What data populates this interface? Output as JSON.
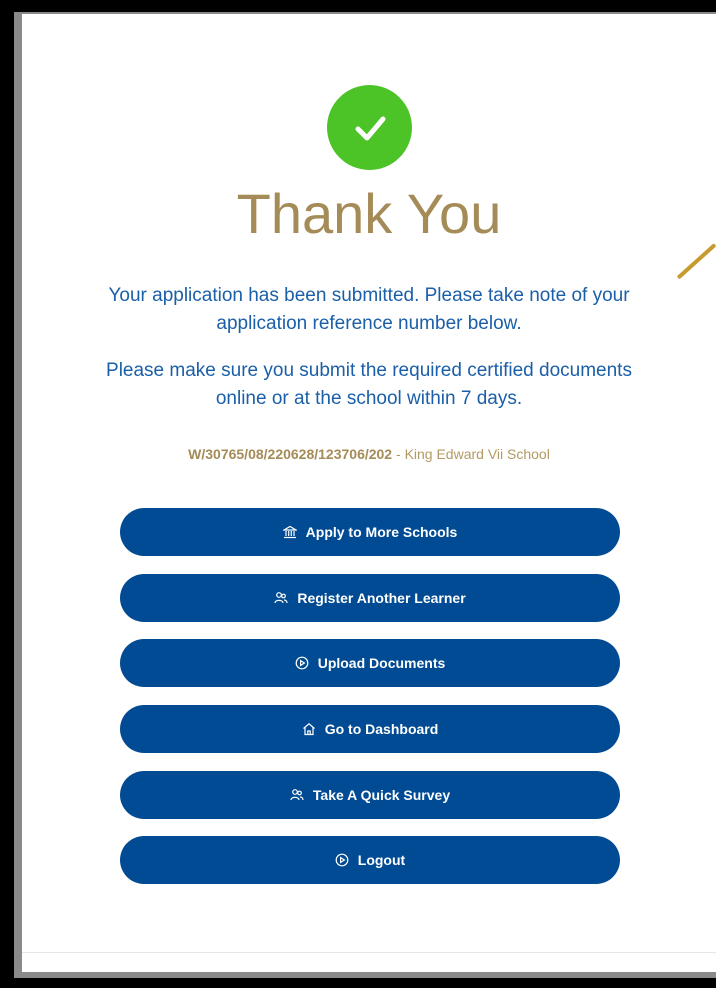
{
  "confirmation": {
    "title": "Thank You",
    "message_submitted": "Your application has been submitted. Please take note of your application reference number below.",
    "message_documents": "Please make sure you submit the required certified documents online or at the school within 7 days.",
    "reference_number": "W/30765/08/220628/123706/202",
    "reference_separator": " - ",
    "school_name": "King Edward Vii School"
  },
  "actions": [
    {
      "label": "Apply to More Schools",
      "icon": "bank-icon"
    },
    {
      "label": "Register Another Learner",
      "icon": "users-icon"
    },
    {
      "label": "Upload Documents",
      "icon": "play-circle-icon"
    },
    {
      "label": "Go to Dashboard",
      "icon": "home-icon"
    },
    {
      "label": "Take A Quick Survey",
      "icon": "users-icon"
    },
    {
      "label": "Logout",
      "icon": "play-circle-icon"
    }
  ],
  "colors": {
    "success": "#4cc326",
    "title_gold": "#a48b57",
    "text_blue": "#1a5fa8",
    "button_blue": "#004b93"
  }
}
